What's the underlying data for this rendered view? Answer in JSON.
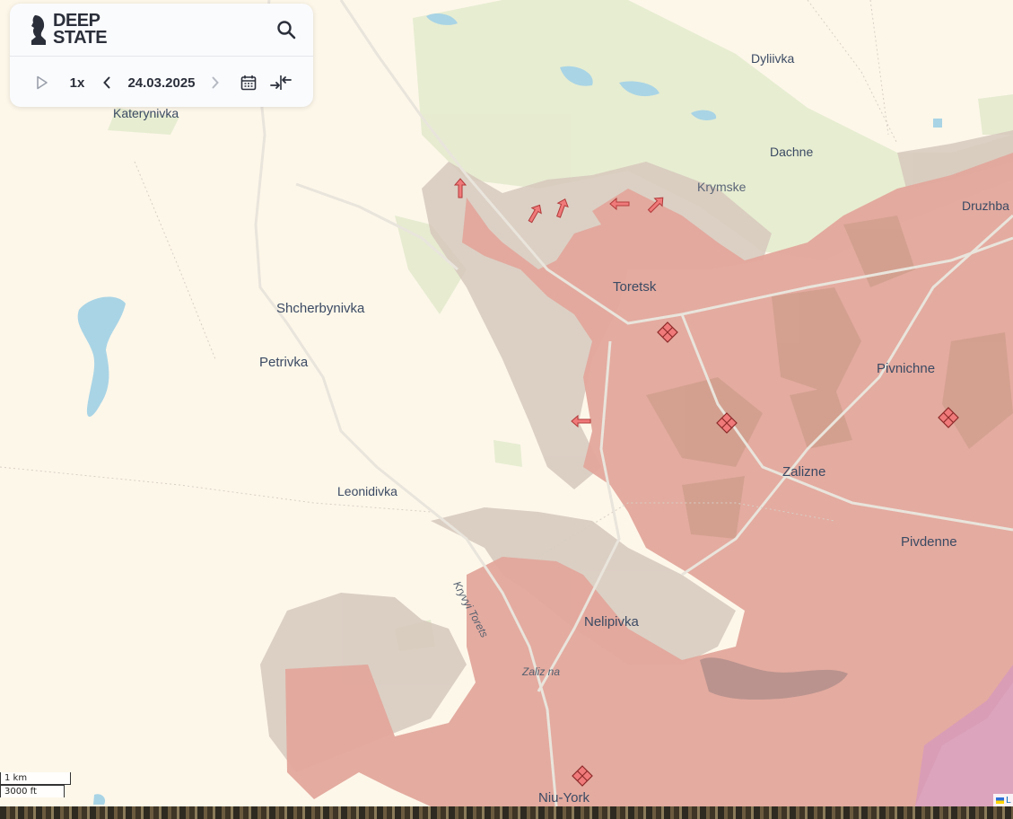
{
  "app": {
    "brand_line1": "DEEP",
    "brand_line2": "STATE",
    "search_icon": "search-icon",
    "play_icon": "play-icon",
    "speed": "1x",
    "date": "24.03.2025",
    "calendar_icon": "calendar-icon",
    "collapse_icon": "arrows-compress-icon"
  },
  "map": {
    "places": [
      {
        "name": "Katerynivka"
      },
      {
        "name": "Dyliivka"
      },
      {
        "name": "Dachne"
      },
      {
        "name": "Krymske"
      },
      {
        "name": "Druzhba"
      },
      {
        "name": "Toretsk"
      },
      {
        "name": "Shcherbynivka"
      },
      {
        "name": "Petrivka"
      },
      {
        "name": "Pivnichne"
      },
      {
        "name": "Zalizne"
      },
      {
        "name": "Leonidivka"
      },
      {
        "name": "Pivdenne"
      },
      {
        "name": "Nelipivka"
      },
      {
        "name": "Niu-York"
      }
    ],
    "river_labels": [
      "Kryvyi Torets",
      "Zaliz na"
    ],
    "colors": {
      "occupied": "#e3a79c",
      "contested": "#d9cbc0",
      "forest": "#e6eccf",
      "water": "#a8d4e6",
      "background": "#fdf7ea",
      "arrow": "#e06a6a"
    }
  },
  "scale": {
    "metric": "1 km",
    "imperial": "3000 ft"
  },
  "attribution": {
    "text": "L"
  }
}
